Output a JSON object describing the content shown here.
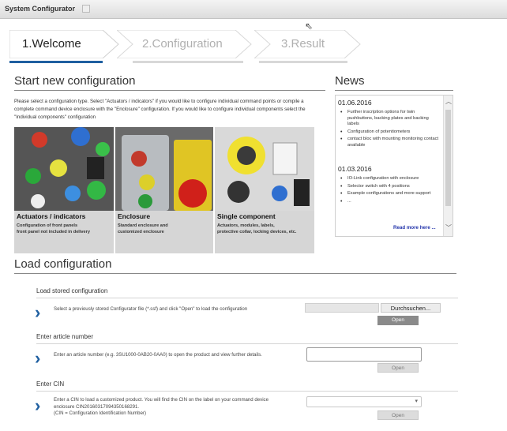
{
  "window": {
    "title": "System Configurator"
  },
  "steps": [
    {
      "label": "1.Welcome",
      "active": true
    },
    {
      "label": "2.Configuration",
      "active": false
    },
    {
      "label": "3.Result",
      "active": false
    }
  ],
  "start": {
    "title": "Start new configuration",
    "intro": "Please select a configuration type. Select \"Actuators / indicators\" if you would like to configure individual command points or compile a complete command device enclosure with the \"Enclosure\" configuration. If you would like to configure individual components select the \"Individual components\" configuration",
    "tiles": [
      {
        "title": "Actuators / indicators",
        "desc": "Configuration of front panels\nfront panel not included in delivery"
      },
      {
        "title": "Enclosure",
        "desc": "Standard enclosure and\ncustomized enclosure"
      },
      {
        "title": "Single component",
        "desc": "Actuators, modules, labels,\nprotective collar, locking devices, etc."
      }
    ]
  },
  "news": {
    "title": "News",
    "groups": [
      {
        "date": "01.06.2016",
        "items": [
          "Further inscription options for twin pushbuttons, backing plates and backing labels",
          "Configuration of potentiometers",
          "contact bloc with mounting monitoring contact available"
        ]
      },
      {
        "date": "01.03.2016",
        "items": [
          "IO-Link configuration with enclosure",
          "Selector switch with 4 positions",
          "Example configurations and more support",
          "..."
        ]
      }
    ],
    "more": "Read more here ..."
  },
  "load": {
    "title": "Load configuration",
    "stored": {
      "label": "Load stored configuration",
      "text": "Select a previously stored Configurator file (*.ssf) and click \"Open\" to load the configuration",
      "browse": "Durchsuchen...",
      "open": "Open"
    },
    "article": {
      "label": "Enter article number",
      "text": "Enter an article number (e.g. 3SU1000-0AB20-0AA0) to open the product and view further details.",
      "value": "",
      "open": "Open"
    },
    "cin": {
      "label": "Enter CIN",
      "text": "Enter a CIN to load a customized product. You will find the CIN on the label on your command device enclosure CIN20160317094350168291.\n(CIN = Configuration Identification Number)",
      "value": "",
      "open": "Open"
    }
  },
  "colors": {
    "accent": "#1f5fa0",
    "step_active_bar": "#1f5fa0"
  }
}
